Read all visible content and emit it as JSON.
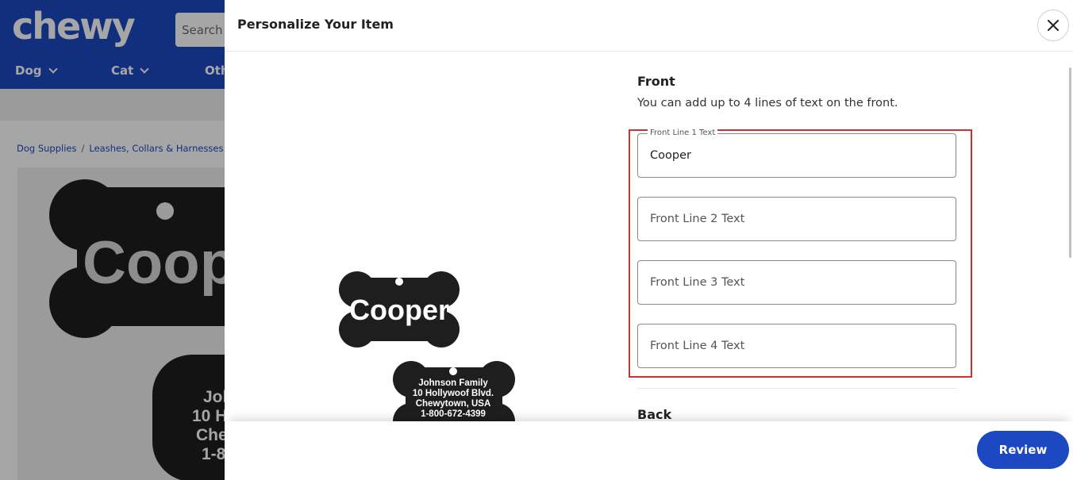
{
  "background": {
    "logo": "chewy",
    "search_placeholder": "Search",
    "nav": [
      "Dog",
      "Cat",
      "Oth"
    ],
    "breadcrumb": [
      "Dog Supplies",
      "Leashes, Collars & Harnesses"
    ],
    "product_tag_text": "Coope",
    "product_back_lines": [
      "Joh",
      "10 H",
      "Che",
      "1-8"
    ]
  },
  "modal": {
    "title": "Personalize Your Item",
    "close_icon": "close-icon",
    "preview": {
      "front_text": "Cooper",
      "back_lines": [
        "Johnson Family",
        "10 Hollywoof Blvd.",
        "Chewytown, USA",
        "1-800-672-4399"
      ]
    },
    "front": {
      "title": "Front",
      "description": "You can add up to 4 lines of text on the front.",
      "fields": [
        {
          "label": "Front Line 1 Text",
          "value": "Cooper",
          "placeholder": "Front Line 1 Text"
        },
        {
          "label": "Front Line 2 Text",
          "value": "",
          "placeholder": "Front Line 2 Text"
        },
        {
          "label": "Front Line 3 Text",
          "value": "",
          "placeholder": "Front Line 3 Text"
        },
        {
          "label": "Front Line 4 Text",
          "value": "",
          "placeholder": "Front Line 4 Text"
        }
      ]
    },
    "back": {
      "title": "Back"
    },
    "review_label": "Review"
  },
  "colors": {
    "brand_blue": "#1c49c2",
    "highlight_red": "#d32f2f"
  }
}
